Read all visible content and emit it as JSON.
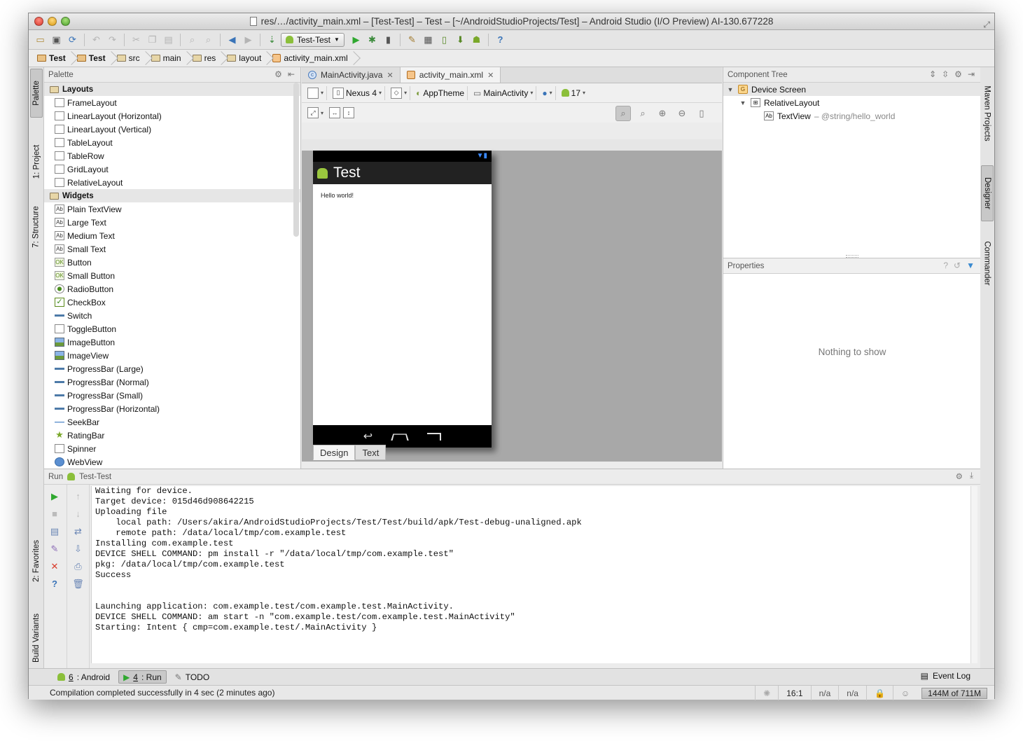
{
  "window": {
    "title": "res/…/activity_main.xml – [Test-Test] – Test – [~/AndroidStudioProjects/Test] – Android Studio (I/O Preview) AI-130.677228"
  },
  "toolbar": {
    "run_config": "Test-Test"
  },
  "breadcrumbs": [
    "Test",
    "Test",
    "src",
    "main",
    "res",
    "layout",
    "activity_main.xml"
  ],
  "left_strip": {
    "palette": "Palette",
    "project": "1: Project",
    "structure": "7: Structure",
    "favorites": "2: Favorites",
    "build_variants": "Build Variants"
  },
  "right_strip": {
    "maven": "Maven Projects",
    "designer": "Designer",
    "commander": "Commander"
  },
  "palette": {
    "header": "Palette",
    "groups": [
      {
        "name": "Layouts",
        "items": [
          {
            "label": "FrameLayout",
            "icon": "frame-layout-icon"
          },
          {
            "label": "LinearLayout (Horizontal)",
            "icon": "linear-layout-icon"
          },
          {
            "label": "LinearLayout (Vertical)",
            "icon": "linear-layout-icon"
          },
          {
            "label": "TableLayout",
            "icon": "table-layout-icon"
          },
          {
            "label": "TableRow",
            "icon": "table-row-icon"
          },
          {
            "label": "GridLayout",
            "icon": "grid-layout-icon"
          },
          {
            "label": "RelativeLayout",
            "icon": "relative-layout-icon"
          }
        ]
      },
      {
        "name": "Widgets",
        "items": [
          {
            "label": "Plain TextView",
            "icon": "textview-icon"
          },
          {
            "label": "Large Text",
            "icon": "textview-icon"
          },
          {
            "label": "Medium Text",
            "icon": "textview-icon"
          },
          {
            "label": "Small Text",
            "icon": "textview-icon"
          },
          {
            "label": "Button",
            "icon": "button-icon"
          },
          {
            "label": "Small Button",
            "icon": "button-icon"
          },
          {
            "label": "RadioButton",
            "icon": "radio-icon"
          },
          {
            "label": "CheckBox",
            "icon": "checkbox-icon"
          },
          {
            "label": "Switch",
            "icon": "switch-icon"
          },
          {
            "label": "ToggleButton",
            "icon": "toggle-icon"
          },
          {
            "label": "ImageButton",
            "icon": "image-button-icon"
          },
          {
            "label": "ImageView",
            "icon": "image-view-icon"
          },
          {
            "label": "ProgressBar (Large)",
            "icon": "progressbar-icon"
          },
          {
            "label": "ProgressBar (Normal)",
            "icon": "progressbar-icon"
          },
          {
            "label": "ProgressBar (Small)",
            "icon": "progressbar-icon"
          },
          {
            "label": "ProgressBar (Horizontal)",
            "icon": "progressbar-icon"
          },
          {
            "label": "SeekBar",
            "icon": "seekbar-icon"
          },
          {
            "label": "RatingBar",
            "icon": "ratingbar-icon"
          },
          {
            "label": "Spinner",
            "icon": "spinner-icon"
          },
          {
            "label": "WebView",
            "icon": "webview-icon"
          }
        ]
      }
    ]
  },
  "editor": {
    "tabs": [
      {
        "label": "MainActivity.java",
        "selected": false
      },
      {
        "label": "activity_main.xml",
        "selected": true
      }
    ],
    "design_toolbar": {
      "device": "Nexus 4",
      "theme": "AppTheme",
      "activity": "MainActivity",
      "api": "17"
    },
    "preview": {
      "app_title": "Test",
      "text": "Hello world!"
    },
    "bottom_tabs": [
      {
        "label": "Design",
        "selected": true
      },
      {
        "label": "Text",
        "selected": false
      }
    ]
  },
  "component_tree": {
    "header": "Component Tree",
    "nodes": {
      "root": "Device Screen",
      "layout": "RelativeLayout",
      "textview": "TextView",
      "textview_detail": "– @string/hello_world"
    }
  },
  "properties": {
    "header": "Properties",
    "empty": "Nothing to show"
  },
  "run": {
    "label": "Run",
    "config": "Test-Test",
    "console": [
      "Waiting for device.",
      "Target device: 015d46d908642215",
      "Uploading file",
      "    local path: /Users/akira/AndroidStudioProjects/Test/Test/build/apk/Test-debug-unaligned.apk",
      "    remote path: /data/local/tmp/com.example.test",
      "Installing com.example.test",
      "DEVICE SHELL COMMAND: pm install -r \"/data/local/tmp/com.example.test\"",
      "pkg: /data/local/tmp/com.example.test",
      "Success",
      "",
      "",
      "Launching application: com.example.test/com.example.test.MainActivity.",
      "DEVICE SHELL COMMAND: am start -n \"com.example.test/com.example.test.MainActivity\"",
      "Starting: Intent { cmp=com.example.test/.MainActivity }"
    ]
  },
  "bottom_tabs": {
    "android_num": "6",
    "android_rest": ": Android",
    "run_num": "4",
    "run_rest": ": Run",
    "todo": "TODO",
    "event_log": "Event Log"
  },
  "status": {
    "message": "Compilation completed successfully in 4 sec (2 minutes ago)",
    "position": "16:1",
    "na1": "n/a",
    "na2": "n/a",
    "memory": "144M of 711M"
  }
}
